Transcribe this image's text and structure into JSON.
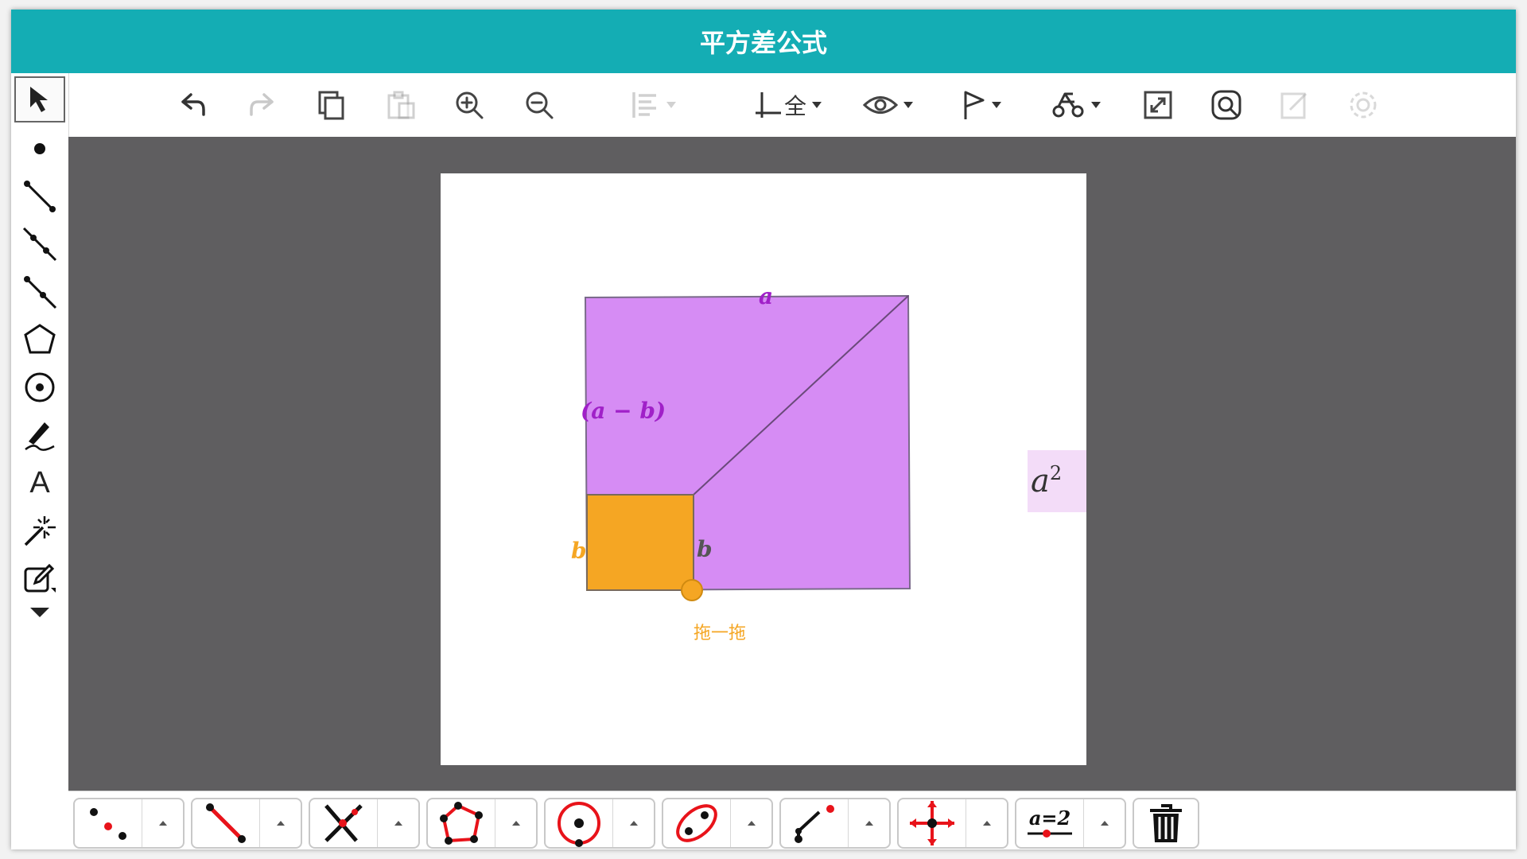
{
  "app": {
    "title": "平方差公式",
    "title_color": "#14adb4"
  },
  "toolbar": {
    "undo": "undo-icon",
    "redo": "redo-icon",
    "copy": "copy-icon",
    "paste": "paste-icon",
    "zoom_in": "zoom-in-icon",
    "zoom_out": "zoom-out-icon",
    "align": "align-icon",
    "axes_label": "全",
    "view": "eye-icon",
    "flag": "flag-icon",
    "trace": "trace-icon",
    "fullscreen": "fullscreen-icon",
    "search": "search-icon",
    "edit": "edit-icon",
    "settings": "gear-icon"
  },
  "sidebar": {
    "items": [
      {
        "name": "move-tool",
        "icon": "arrow-icon"
      },
      {
        "name": "point-tool",
        "icon": "point-icon"
      },
      {
        "name": "segment-tool",
        "icon": "segment-icon"
      },
      {
        "name": "line-tool",
        "icon": "line-icon"
      },
      {
        "name": "ray-tool",
        "icon": "ray-icon"
      },
      {
        "name": "polygon-tool",
        "icon": "polygon-icon"
      },
      {
        "name": "circle-tool",
        "icon": "circle-icon"
      },
      {
        "name": "pen-tool",
        "icon": "pen-icon"
      },
      {
        "name": "text-tool",
        "label": "A"
      },
      {
        "name": "special-tool",
        "icon": "sparkle-icon"
      },
      {
        "name": "edit-tool",
        "icon": "edit-icon"
      },
      {
        "name": "more-tool",
        "icon": "chevron-down-icon"
      }
    ]
  },
  "applet": {
    "label_top": "a",
    "label_left": "(a − b)",
    "label_b_left": "b",
    "label_b_right": "b",
    "drag_text": "拖一拖",
    "formula_base": "a",
    "formula_exp": "2",
    "colors": {
      "large_square": "#d68cf4",
      "small_square": "#f5a623",
      "purple_text": "#a020c8",
      "orange_text": "#f5a623",
      "dark_text": "#555555",
      "canvas_bg": "#5f5e60"
    }
  },
  "bottombar": {
    "tools": [
      "points-tool-icon",
      "segment-tool-icon",
      "intersect-tool-icon",
      "polygon-tool-icon",
      "circle-tool-icon",
      "ellipse-tool-icon",
      "curve-tool-icon",
      "move-axes-tool-icon",
      "slider-tool-icon"
    ],
    "slider_label": "a=2",
    "delete": "trash-icon"
  }
}
